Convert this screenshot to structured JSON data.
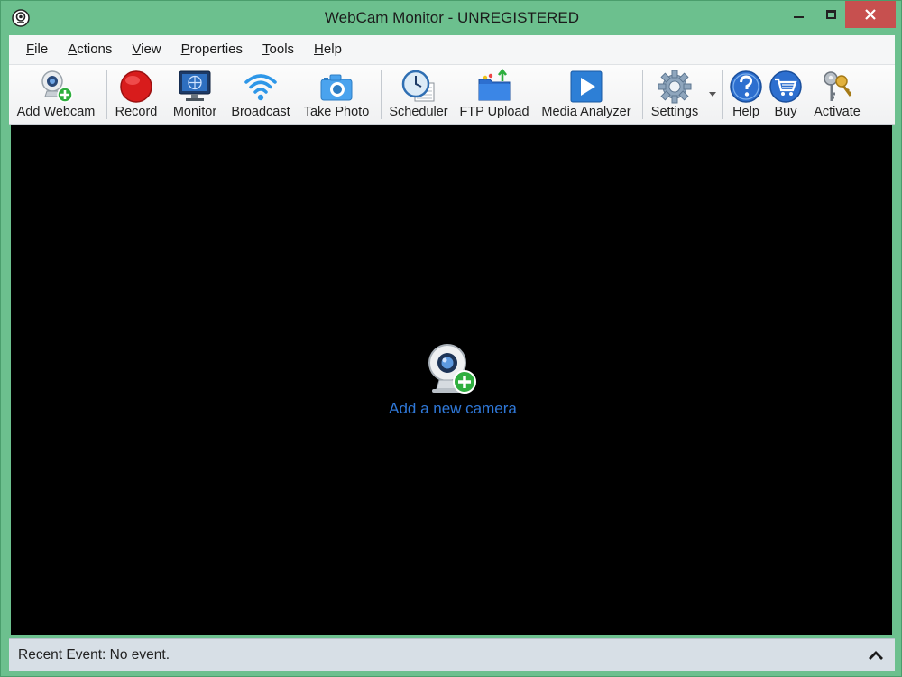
{
  "window": {
    "title": "WebCam Monitor - UNREGISTERED",
    "frame_color": "#6cc08e",
    "close_color": "#c7504f"
  },
  "menu": {
    "items": [
      {
        "accel": "F",
        "rest": "ile"
      },
      {
        "accel": "A",
        "rest": "ctions"
      },
      {
        "accel": "V",
        "rest": "iew"
      },
      {
        "accel": "P",
        "rest": "roperties"
      },
      {
        "accel": "T",
        "rest": "ools"
      },
      {
        "accel": "H",
        "rest": "elp"
      }
    ]
  },
  "toolbar": {
    "buttons": [
      {
        "label": "Add Webcam",
        "icon": "webcam-add-icon"
      },
      {
        "label": "Record",
        "icon": "record-icon"
      },
      {
        "label": "Monitor",
        "icon": "monitor-icon"
      },
      {
        "label": "Broadcast",
        "icon": "wifi-broadcast-icon"
      },
      {
        "label": "Take Photo",
        "icon": "camera-icon"
      },
      {
        "label": "Scheduler",
        "icon": "clock-calendar-icon"
      },
      {
        "label": "FTP Upload",
        "icon": "folder-upload-icon"
      },
      {
        "label": "Media Analyzer",
        "icon": "play-icon"
      },
      {
        "label": "Settings",
        "icon": "gear-icon"
      },
      {
        "label": "Help",
        "icon": "help-icon"
      },
      {
        "label": "Buy",
        "icon": "cart-icon"
      },
      {
        "label": "Activate",
        "icon": "keys-icon"
      }
    ]
  },
  "main": {
    "add_camera_label": "Add a new camera",
    "link_color": "#2f78d8"
  },
  "status": {
    "text": "Recent Event: No event."
  }
}
